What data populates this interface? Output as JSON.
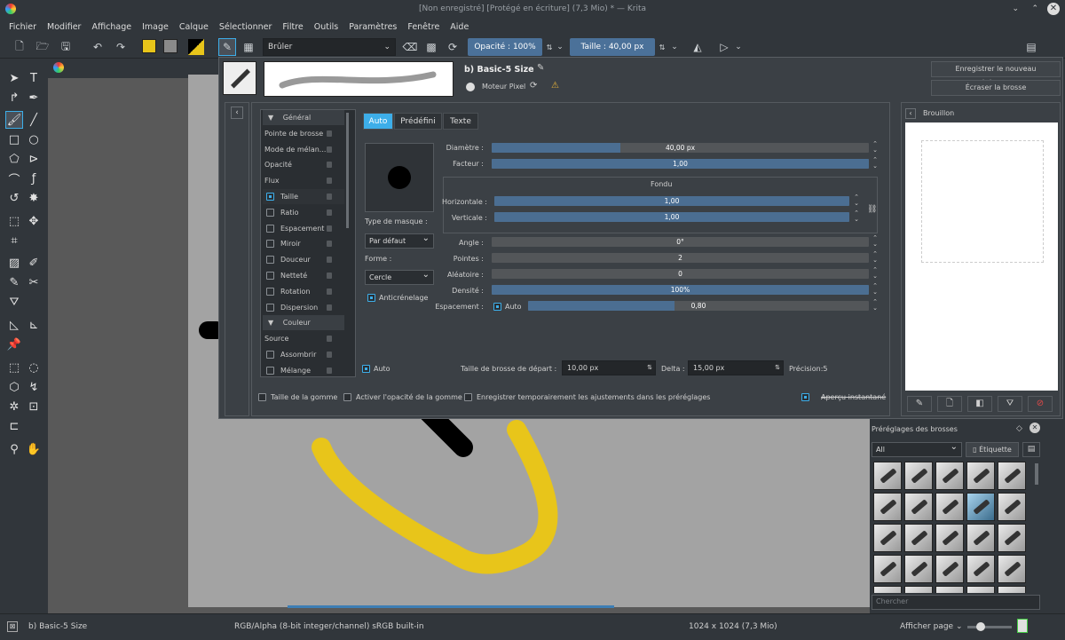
{
  "window": {
    "title": "[Non enregistré] [Protégé en écriture] (7,3 Mio) * — Krita"
  },
  "menu": [
    "Fichier",
    "Modifier",
    "Affichage",
    "Image",
    "Calque",
    "Sélectionner",
    "Filtre",
    "Outils",
    "Paramètres",
    "Fenêtre",
    "Aide"
  ],
  "toolbar": {
    "blend_mode": "Brûler",
    "opacity_label": "Opacité :",
    "opacity_value": "100%",
    "size_label": "Taille :",
    "size_value": "40,00 px"
  },
  "editor": {
    "preset_name": "b) Basic-5 Size",
    "engine": "Moteur Pixel",
    "save_new_button": "Enregistrer le nouveau préréglage...",
    "overwrite_button": "Écraser la brosse",
    "nav_items": [
      {
        "label": "Général",
        "checkbox": false,
        "checked": false,
        "header": true
      },
      {
        "label": "Pointe de brosse",
        "checkbox": false,
        "checked": false
      },
      {
        "label": "Mode de mélan...",
        "checkbox": false,
        "checked": false
      },
      {
        "label": "Opacité",
        "checkbox": false,
        "checked": false
      },
      {
        "label": "Flux",
        "checkbox": false,
        "checked": false
      },
      {
        "label": "Taille",
        "checkbox": true,
        "checked": true
      },
      {
        "label": "Ratio",
        "checkbox": true,
        "checked": false
      },
      {
        "label": "Espacement",
        "checkbox": true,
        "checked": false
      },
      {
        "label": "Miroir",
        "checkbox": true,
        "checked": false
      },
      {
        "label": "Douceur",
        "checkbox": true,
        "checked": false
      },
      {
        "label": "Netteté",
        "checkbox": true,
        "checked": false
      },
      {
        "label": "Rotation",
        "checkbox": true,
        "checked": false
      },
      {
        "label": "Dispersion",
        "checkbox": true,
        "checked": false
      },
      {
        "label": "Couleur",
        "checkbox": false,
        "checked": false,
        "header": true
      },
      {
        "label": "Source",
        "checkbox": false,
        "checked": false
      },
      {
        "label": "Assombrir",
        "checkbox": true,
        "checked": false
      },
      {
        "label": "Mélange",
        "checkbox": true,
        "checked": false
      }
    ],
    "tabs": [
      "Auto",
      "Prédéfini",
      "Texte"
    ],
    "mask_type_label": "Type de masque :",
    "mask_type_value": "Par défaut",
    "shape_label": "Forme :",
    "shape_value": "Cercle",
    "antialias_label": "Anticrénelage",
    "diameter_label": "Diamètre :",
    "diameter_value": "40,00 px",
    "diameter_fraction": 0.34,
    "factor_label": "Facteur :",
    "factor_value": "1,00",
    "fondu_title": "Fondu",
    "horizontal_label": "Horizontale :",
    "horizontal_value": "1,00",
    "vertical_label": "Verticale :",
    "vertical_value": "1,00",
    "angle_label": "Angle :",
    "angle_value": "0°",
    "points_label": "Pointes :",
    "points_value": "2",
    "random_label": "Aléatoire :",
    "random_value": "0",
    "density_label": "Densité :",
    "density_value": "100%",
    "spacing_label": "Espacement :",
    "spacing_auto": "Auto",
    "spacing_value": "0,80",
    "spacing_fraction": 0.43,
    "auto_label": "Auto",
    "start_size_label": "Taille de brosse de départ :",
    "start_size_value": "10,00 px",
    "delta_label": "Delta :",
    "delta_value": "15,00 px",
    "precision": "Précision:5",
    "eraser_size": "Taille de la gomme",
    "eraser_opacity": "Activer l'opacité de la gomme",
    "temp_save": "Enregistrer temporairement les ajustements dans les préréglages",
    "instant_preview": "Aperçu instantané",
    "scratchpad_title": "Brouillon"
  },
  "presets": {
    "title": "Préréglages des brosses",
    "filter": "All",
    "tag_button": "Étiquette",
    "search_placeholder": "Chercher"
  },
  "status": {
    "brush": "b) Basic-5 Size",
    "color": "RGB/Alpha (8-bit integer/channel)  sRGB built-in",
    "dimensions": "1024 x 1024 (7,3 Mio)",
    "zoom_mode": "Afficher page"
  },
  "colors": {
    "accent": "#3daee9",
    "slider_fill": "#4b6e92",
    "stroke_yellow": "#e8c51a"
  }
}
